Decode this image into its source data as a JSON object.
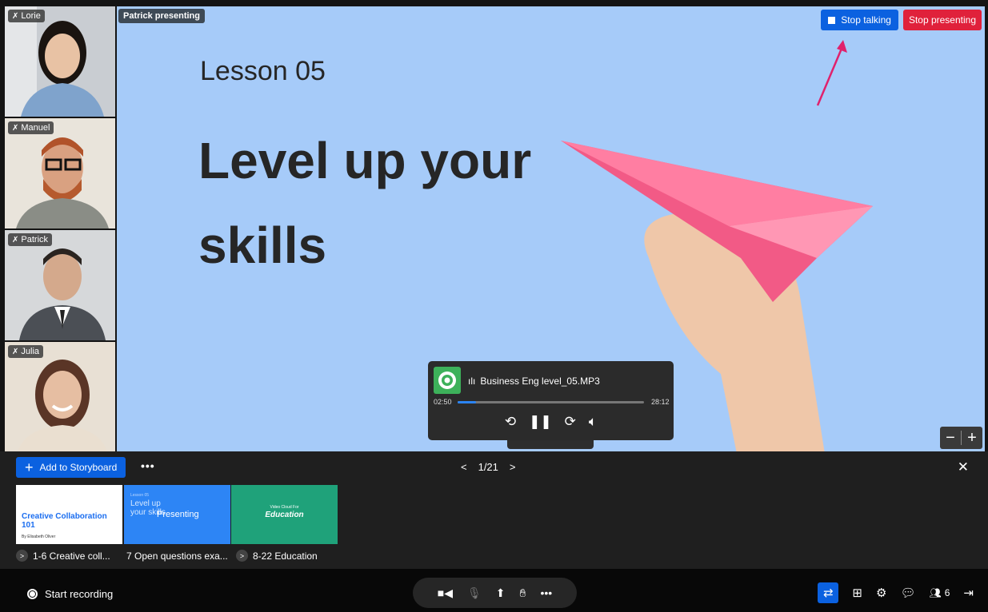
{
  "participants": [
    {
      "name": "Lorie",
      "muted": true
    },
    {
      "name": "Manuel",
      "muted": true
    },
    {
      "name": "Patrick",
      "muted": true
    },
    {
      "name": "Julia",
      "muted": true
    }
  ],
  "stage": {
    "presenter_label": "Patrick presenting",
    "slide": {
      "lesson": "Lesson 05",
      "headline": "Level up your skills"
    },
    "stop_talking_label": "Stop talking",
    "stop_presenting_label": "Stop presenting",
    "zoom_out": "−",
    "zoom_in": "+"
  },
  "player": {
    "title": "Business Eng level_05.MP3",
    "current_time": "02:50",
    "total_time": "28:12",
    "progress": 0.1
  },
  "storyboard": {
    "add_label": "Add to Storyboard",
    "more_icon": "more-dots-icon",
    "page": "1/21",
    "thumbnails": [
      {
        "title": "Creative Collaboration 101",
        "subtitle": "By Elisabeth Oliver"
      },
      {
        "small": "Lesson 05",
        "title": "Level up your skills",
        "overlay": "Presenting"
      },
      {
        "small": "Video Cloud For",
        "title": "Education"
      }
    ],
    "chapters": [
      {
        "label": "1-6 Creative coll..."
      },
      {
        "label": "7 Open questions exa..."
      },
      {
        "label": "8-22 Education"
      }
    ]
  },
  "bottombar": {
    "record_label": "Start recording",
    "participant_count": "6"
  },
  "colors": {
    "accent": "#0b61e0",
    "danger": "#e0213b",
    "stage_bg": "#a6cbf9"
  }
}
